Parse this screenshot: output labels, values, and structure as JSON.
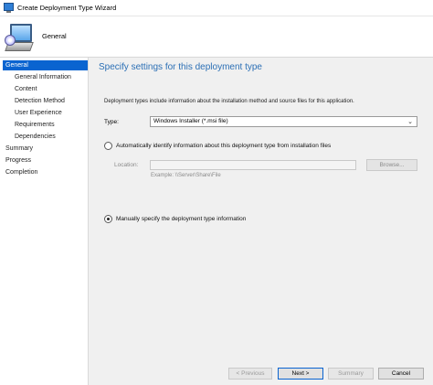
{
  "window": {
    "title": "Create Deployment Type Wizard"
  },
  "header": {
    "page_name": "General"
  },
  "sidebar": {
    "items": [
      {
        "label": "General",
        "level": 0,
        "active": true
      },
      {
        "label": "General Information",
        "level": 1,
        "active": false
      },
      {
        "label": "Content",
        "level": 1,
        "active": false
      },
      {
        "label": "Detection Method",
        "level": 1,
        "active": false
      },
      {
        "label": "User Experience",
        "level": 1,
        "active": false
      },
      {
        "label": "Requirements",
        "level": 1,
        "active": false
      },
      {
        "label": "Dependencies",
        "level": 1,
        "active": false
      },
      {
        "label": "Summary",
        "level": 0,
        "active": false
      },
      {
        "label": "Progress",
        "level": 0,
        "active": false
      },
      {
        "label": "Completion",
        "level": 0,
        "active": false
      }
    ]
  },
  "main": {
    "heading": "Specify settings for this deployment type",
    "description": "Deployment types include information about the installation method and source files for this application.",
    "type_label": "Type:",
    "type_value": "Windows Installer (*.msi file)",
    "auto_option_label": "Automatically identify information about this deployment type from installation files",
    "location_label": "Location:",
    "location_value": "",
    "browse_label": "Browse...",
    "example_text": "Example: \\\\Server\\Share\\File",
    "manual_option_label": "Manually specify the deployment type information",
    "selected_option": "manual"
  },
  "footer": {
    "previous_label": "< Previous",
    "next_label": "Next >",
    "summary_label": "Summary",
    "cancel_label": "Cancel"
  },
  "colors": {
    "heading": "#2b6fb5",
    "active_nav": "#0a64d0",
    "content_bg": "#f0f0f0"
  }
}
